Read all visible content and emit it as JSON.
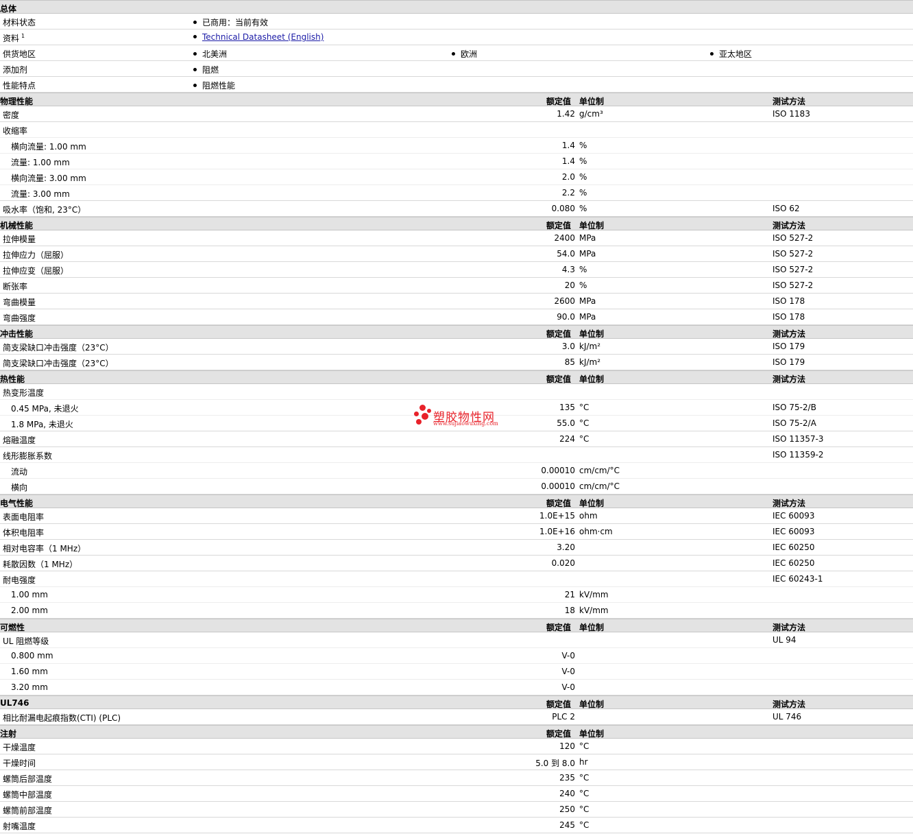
{
  "general": {
    "title": "总体",
    "material_status": {
      "label": "材料状态",
      "value": "已商用：当前有效"
    },
    "docs": {
      "label": "资料",
      "sup": "1",
      "link": "Technical Datasheet (English)"
    },
    "supply": {
      "label": "供货地区",
      "regions": [
        "北美洲",
        "欧洲",
        "亚太地区"
      ]
    },
    "additive": {
      "label": "添加剂",
      "value": "阻燃"
    },
    "feature": {
      "label": "性能特点",
      "value": "阻燃性能"
    }
  },
  "headers": {
    "value": "额定值",
    "unit": "单位制",
    "test": "测试方法"
  },
  "sections": [
    {
      "title": "物理性能",
      "has_unit": true,
      "has_test": true,
      "rows": [
        {
          "name": "密度",
          "value": "1.42",
          "unit": "g/cm³",
          "test": "ISO 1183"
        },
        {
          "name": "收缩率",
          "value": "",
          "unit": "",
          "test": ""
        },
        {
          "name": "横向流量: 1.00 mm",
          "indent": true,
          "value": "1.4",
          "unit": "%",
          "test": ""
        },
        {
          "name": "流量: 1.00 mm",
          "indent": true,
          "value": "1.4",
          "unit": "%",
          "test": ""
        },
        {
          "name": "横向流量: 3.00 mm",
          "indent": true,
          "value": "2.0",
          "unit": "%",
          "test": ""
        },
        {
          "name": "流量: 3.00 mm",
          "indent": true,
          "value": "2.2",
          "unit": "%",
          "test": ""
        },
        {
          "name": "吸水率（饱和, 23°C）",
          "value": "0.080",
          "unit": "%",
          "test": "ISO 62"
        }
      ]
    },
    {
      "title": "机械性能",
      "has_unit": true,
      "has_test": true,
      "rows": [
        {
          "name": "拉伸模量",
          "value": "2400",
          "unit": "MPa",
          "test": "ISO 527-2"
        },
        {
          "name": "拉伸应力（屈服）",
          "value": "54.0",
          "unit": "MPa",
          "test": "ISO 527-2"
        },
        {
          "name": "拉伸应变（屈服）",
          "value": "4.3",
          "unit": "%",
          "test": "ISO 527-2"
        },
        {
          "name": "断张率",
          "value": "20",
          "unit": "%",
          "test": "ISO 527-2"
        },
        {
          "name": "弯曲模量",
          "value": "2600",
          "unit": "MPa",
          "test": "ISO 178"
        },
        {
          "name": "弯曲强度",
          "value": "90.0",
          "unit": "MPa",
          "test": "ISO 178"
        }
      ]
    },
    {
      "title": "冲击性能",
      "has_unit": true,
      "has_test": true,
      "rows": [
        {
          "name": "简支梁缺口冲击强度（23°C）",
          "value": "3.0",
          "unit": "kJ/m²",
          "test": "ISO 179"
        },
        {
          "name": "简支梁缺口冲击强度（23°C）",
          "value": "85",
          "unit": "kJ/m²",
          "test": "ISO 179"
        }
      ]
    },
    {
      "title": "热性能",
      "has_unit": true,
      "has_test": true,
      "rows": [
        {
          "name": "热变形温度",
          "value": "",
          "unit": "",
          "test": ""
        },
        {
          "name": "0.45 MPa, 未退火",
          "indent": true,
          "value": "135",
          "unit": "°C",
          "test": "ISO 75-2/B"
        },
        {
          "name": "1.8 MPa, 未退火",
          "indent": true,
          "value": "55.0",
          "unit": "°C",
          "test": "ISO 75-2/A"
        },
        {
          "name": "熔融温度",
          "value": "224",
          "unit": "°C",
          "test": "ISO 11357-3"
        },
        {
          "name": "线形膨胀系数",
          "value": "",
          "unit": "",
          "test": "ISO 11359-2"
        },
        {
          "name": "流动",
          "indent": true,
          "value": "0.00010",
          "unit": "cm/cm/°C",
          "test": ""
        },
        {
          "name": "横向",
          "indent": true,
          "value": "0.00010",
          "unit": "cm/cm/°C",
          "test": ""
        }
      ]
    },
    {
      "title": "电气性能",
      "has_unit": true,
      "has_test": true,
      "rows": [
        {
          "name": "表面电阻率",
          "value": "1.0E+15",
          "unit": "ohm",
          "test": "IEC 60093"
        },
        {
          "name": "体积电阻率",
          "value": "1.0E+16",
          "unit": "ohm·cm",
          "test": "IEC 60093"
        },
        {
          "name": "相对电容率（1 MHz）",
          "value": "3.20",
          "unit": "",
          "test": "IEC 60250"
        },
        {
          "name": "耗散因数（1 MHz）",
          "value": "0.020",
          "unit": "",
          "test": "IEC 60250"
        },
        {
          "name": "耐电强度",
          "value": "",
          "unit": "",
          "test": "IEC 60243-1"
        },
        {
          "name": "1.00 mm",
          "indent": true,
          "value": "21",
          "unit": "kV/mm",
          "test": ""
        },
        {
          "name": "2.00 mm",
          "indent": true,
          "value": "18",
          "unit": "kV/mm",
          "test": ""
        }
      ]
    },
    {
      "title": "可燃性",
      "has_unit": true,
      "has_test": true,
      "rows": [
        {
          "name": "UL 阻燃等级",
          "value": "",
          "unit": "",
          "test": "UL 94"
        },
        {
          "name": "0.800 mm",
          "indent": true,
          "value": "V-0",
          "unit": "",
          "test": ""
        },
        {
          "name": "1.60 mm",
          "indent": true,
          "value": "V-0",
          "unit": "",
          "test": ""
        },
        {
          "name": "3.20 mm",
          "indent": true,
          "value": "V-0",
          "unit": "",
          "test": ""
        }
      ]
    },
    {
      "title": "UL746",
      "has_unit": true,
      "has_test": true,
      "rows": [
        {
          "name": "相比耐漏电起痕指数(CTI) (PLC)",
          "value": "PLC 2",
          "unit": "",
          "test": "UL 746"
        }
      ]
    },
    {
      "title": "注射",
      "has_unit": true,
      "has_test": false,
      "rows": [
        {
          "name": "干燥温度",
          "value": "120",
          "unit": "°C",
          "test": ""
        },
        {
          "name": "干燥时间",
          "value": "5.0 到  8.0",
          "unit": "hr",
          "test": ""
        },
        {
          "name": "螺筒后部温度",
          "value": "235",
          "unit": "°C",
          "test": ""
        },
        {
          "name": "螺筒中部温度",
          "value": "240",
          "unit": "°C",
          "test": ""
        },
        {
          "name": "螺筒前部温度",
          "value": "250",
          "unit": "°C",
          "test": ""
        },
        {
          "name": "射嘴温度",
          "value": "245",
          "unit": "°C",
          "test": ""
        }
      ]
    }
  ],
  "watermark": {
    "cn": "塑胶物性网",
    "url": "www.sujiaowuxing.com",
    "color": "#e8222a"
  }
}
